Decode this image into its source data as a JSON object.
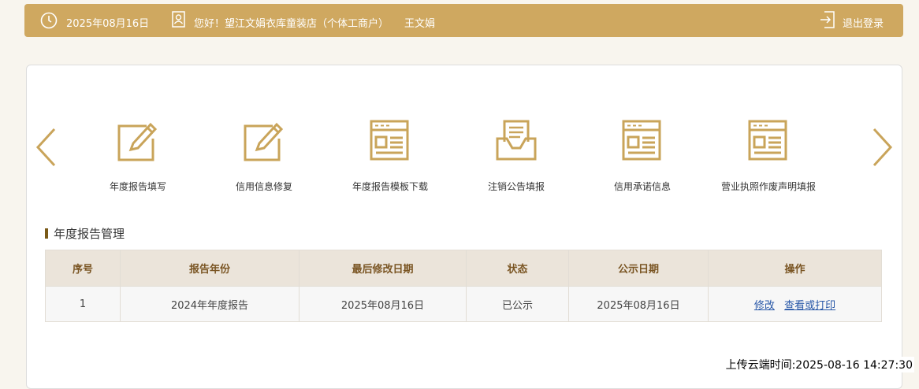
{
  "header": {
    "date": "2025年08月16日",
    "greeting": "您好！望江文娟衣库童装店（个体工商户）",
    "user": "王文娟",
    "logout_label": "退出登录"
  },
  "menu": [
    {
      "label": "年度报告填写",
      "icon": "edit-icon"
    },
    {
      "label": "信用信息修复",
      "icon": "edit-icon"
    },
    {
      "label": "年度报告模板下载",
      "icon": "template-icon"
    },
    {
      "label": "注销公告填报",
      "icon": "inbox-document-icon"
    },
    {
      "label": "信用承诺信息",
      "icon": "template-icon"
    },
    {
      "label": "营业执照作废声明填报",
      "icon": "template-icon"
    }
  ],
  "section": {
    "title": "年度报告管理"
  },
  "table": {
    "headers": [
      "序号",
      "报告年份",
      "最后修改日期",
      "状态",
      "公示日期",
      "操作"
    ],
    "rows": [
      {
        "index": "1",
        "year": "2024年年度报告",
        "modified": "2025年08月16日",
        "status": "已公示",
        "published": "2025年08月16日",
        "actions": [
          "修改",
          "查看或打印"
        ]
      }
    ]
  },
  "footer": {
    "upload_time": "上传云端时间:2025-08-16 14:27:30"
  },
  "colors": {
    "accent": "#cfa860",
    "link": "#2a59a8"
  }
}
